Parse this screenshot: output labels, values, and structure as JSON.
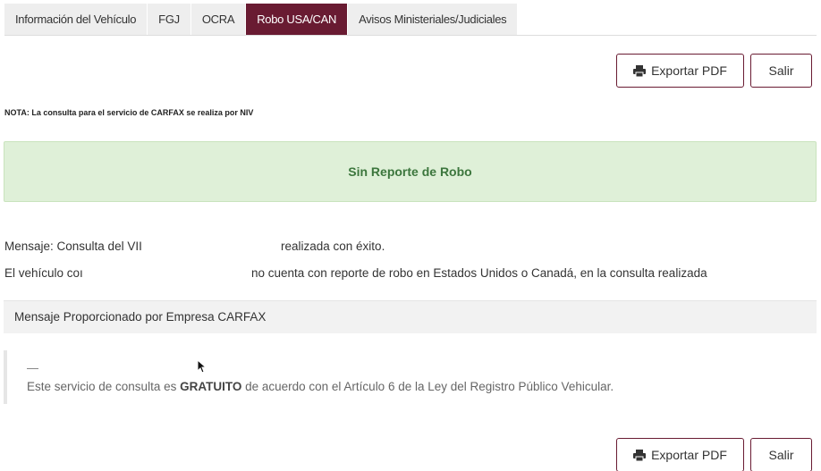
{
  "tabs": [
    {
      "label": "Información del Vehículo",
      "active": false
    },
    {
      "label": "FGJ",
      "active": false
    },
    {
      "label": "OCRA",
      "active": false
    },
    {
      "label": "Robo USA/CAN",
      "active": true
    },
    {
      "label": "Avisos Ministeriales/Judiciales",
      "active": false
    }
  ],
  "actions": {
    "export_label": "Exportar PDF",
    "exit_label": "Salir",
    "export_icon": "print-icon"
  },
  "nota": "NOTA: La consulta para el servicio de CARFAX se realiza por NIV",
  "alert": {
    "text": "Sin Reporte de Robo",
    "color": "#3c763d",
    "background": "#dff0d8"
  },
  "mensaje": {
    "line1_prefix": "Mensaje: Consulta del VII",
    "line1_suffix": "realizada con éxito.",
    "line2_prefix": "El vehículo coı",
    "line2_suffix": "no cuenta con reporte de robo en Estados Unidos o Canadá, en la consulta realizada"
  },
  "panel": {
    "heading": "Mensaje Proporcionado por Empresa CARFAX"
  },
  "quote": {
    "dash": "—",
    "text_before": "Este servicio de consulta es ",
    "text_bold": "GRATUITO",
    "text_after": " de acuerdo con el Artículo 6 de la Ley del Registro Público Vehicular."
  },
  "colors": {
    "accent": "#691b32"
  }
}
